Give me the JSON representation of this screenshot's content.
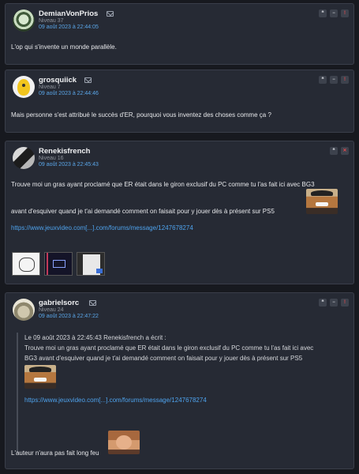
{
  "posts": [
    {
      "username": "DemianVonPrios",
      "level": "Niveau 37",
      "date": "09 août 2023 à 22:44:05",
      "text": "L'op qui s'invente un monde parallèle."
    },
    {
      "username": "grosquiick",
      "level": "Niveau 7",
      "date": "09 août 2023 à 22:44:46",
      "text": "Mais personne s'est attribué le succès d'ER, pourquoi vous inventez des choses comme ça ?"
    },
    {
      "username": "Renekisfrench",
      "level": "Niveau 16",
      "date": "09 août 2023 à 22:45:43",
      "line1": "Trouve moi un gras ayant proclamé que ER était dans le giron exclusif du PC comme tu l'as fait ici avec BG3",
      "line2": "avant d'esquiver quand je t'ai demandé comment on faisait pour y jouer dès à présent sur PS5",
      "link": "https://www.jeuxvideo.com[...].com/forums/message/1247678274"
    },
    {
      "username": "gabrielsorc",
      "level": "Niveau 24",
      "date": "09 août 2023 à 22:47:22",
      "quote_header": "Le 09 août 2023 à 22:45:43 Renekisfrench a écrit :",
      "quote_line1": "Trouve moi un gras ayant proclamé que ER était dans le giron exclusif du PC comme tu l'as fait ici avec",
      "quote_line2": "BG3 avant d'esquiver quand je t'ai demandé comment on faisait pour y jouer dès à présent sur PS5",
      "quote_link": "https://www.jeuxvideo.com[...].com/forums/message/1247678274",
      "text": "L'auteur n'aura pas fait long feu"
    }
  ],
  "icons": {
    "quote": "❝",
    "minus": "−",
    "report": "!",
    "delete": "✕"
  },
  "colors": {
    "link": "#4ea3ee",
    "date": "#5aa6e8",
    "danger": "#e5484d"
  }
}
